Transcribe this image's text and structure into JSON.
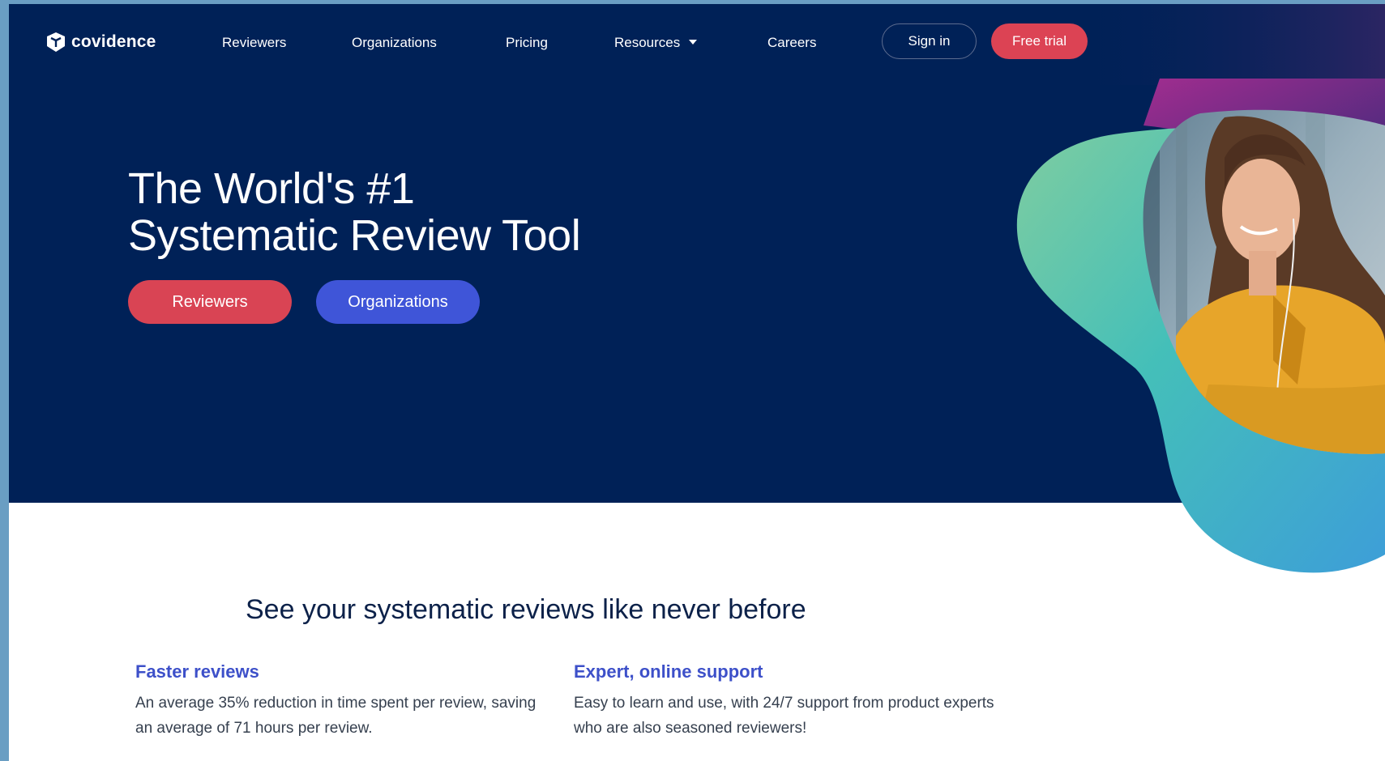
{
  "brand": {
    "name": "covidence"
  },
  "nav": {
    "links": [
      "Reviewers",
      "Organizations",
      "Pricing",
      "Resources",
      "Careers"
    ],
    "sign_in": "Sign in",
    "free_trial": "Free trial"
  },
  "hero": {
    "title_line1": "The World's #1",
    "title_line2": "Systematic Review Tool",
    "cta_reviewers": "Reviewers",
    "cta_organizations": "Organizations"
  },
  "section": {
    "heading": "See your systematic reviews like never before",
    "features": [
      {
        "title": "Faster reviews",
        "text": "An average 35% reduction in time spent per review, saving an average of 71 hours per review."
      },
      {
        "title": "Expert, online support",
        "text": "Easy to learn and use, with 24/7 support from product experts who are also seasoned reviewers!"
      }
    ]
  },
  "colors": {
    "navy": "#002157",
    "red": "#dc4354",
    "blue": "#3f55d8",
    "feature_title": "#3d50c9",
    "heading": "#0c2149"
  },
  "icons": [
    "covidence-logo-icon",
    "chevron-down-icon"
  ]
}
